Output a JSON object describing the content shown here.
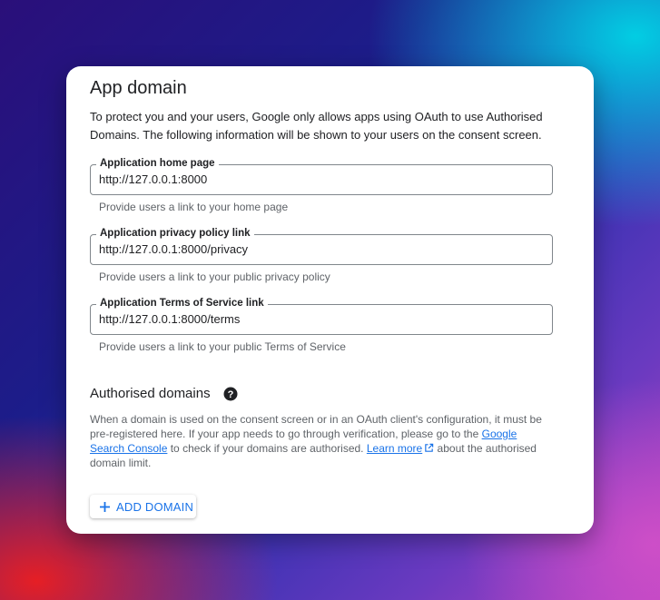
{
  "section": {
    "title": "App domain",
    "intro": "To protect you and your users, Google only allows apps using OAuth to use Authorised Domains. The following information will be shown to your users on the consent screen."
  },
  "fields": [
    {
      "label": "Application home page",
      "value": "http://127.0.0.1:8000",
      "helper": "Provide users a link to your home page"
    },
    {
      "label": "Application privacy policy link",
      "value": "http://127.0.0.1:8000/privacy",
      "helper": "Provide users a link to your public privacy policy"
    },
    {
      "label": "Application Terms of Service link",
      "value": "http://127.0.0.1:8000/terms",
      "helper": "Provide users a link to your public Terms of Service"
    }
  ],
  "authorised": {
    "heading": "Authorised domains",
    "desc_part1": "When a domain is used on the consent screen or in an OAuth client's configuration, it must be pre-registered here. If your app needs to go through verification, please go to the ",
    "console_link": "Google Search Console",
    "desc_part2": " to check if your domains are authorised. ",
    "learn_more_link": "Learn more",
    "desc_part3": " about the authorised domain limit.",
    "add_button": "ADD DOMAIN"
  },
  "icons": {
    "help": "help-circle-icon",
    "external": "external-link-icon",
    "add": "plus-icon"
  },
  "colors": {
    "accent": "#1a73e8",
    "text": "#202124",
    "secondary_text": "#5f6368",
    "outline": "#80868b"
  }
}
